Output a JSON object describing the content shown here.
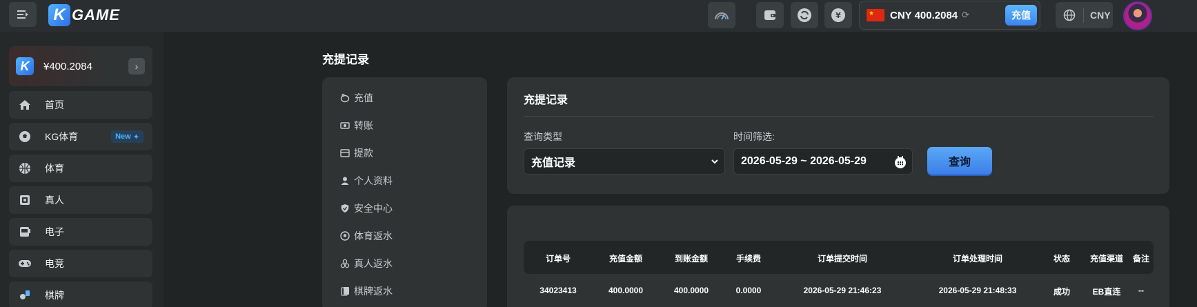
{
  "header": {
    "logo_k": "K",
    "logo_text": "GAME",
    "balance_currency_amount": "CNY 400.2084",
    "deposit_label": "充值",
    "currency_code": "CNY"
  },
  "sidebar": {
    "wallet_amount": "¥400.2084",
    "items": [
      {
        "label": "首页",
        "icon": "home-icon"
      },
      {
        "label": "KG体育",
        "icon": "soccer-ball-icon",
        "badge": "New"
      },
      {
        "label": "体育",
        "icon": "basketball-icon"
      },
      {
        "label": "真人",
        "icon": "cards-icon"
      },
      {
        "label": "电子",
        "icon": "slot-machine-icon"
      },
      {
        "label": "电竞",
        "icon": "gamepad-icon"
      },
      {
        "label": "棋牌",
        "icon": "chess-icon"
      }
    ]
  },
  "page": {
    "title": "充提记录"
  },
  "subnav": {
    "items": [
      {
        "label": "充值",
        "icon": "piggy-bank-icon"
      },
      {
        "label": "转账",
        "icon": "transfer-icon"
      },
      {
        "label": "提款",
        "icon": "withdraw-icon"
      },
      {
        "label": "个人资料",
        "icon": "user-icon"
      },
      {
        "label": "安全中心",
        "icon": "shield-icon"
      },
      {
        "label": "体育返水",
        "icon": "soccer-ball-icon"
      },
      {
        "label": "真人返水",
        "icon": "chips-icon"
      },
      {
        "label": "棋牌返水",
        "icon": "cards-icon"
      }
    ]
  },
  "filter": {
    "title": "充提记录",
    "query_type_label": "查询类型",
    "query_type_value": "充值记录",
    "time_label": "时间筛选:",
    "date_range": "2026-05-29 ~ 2026-05-29",
    "query_button": "查询"
  },
  "table": {
    "headers": [
      "订单号",
      "充值金额",
      "到账金额",
      "手续费",
      "订单提交时间",
      "订单处理时间",
      "状态",
      "充值渠道",
      "备注"
    ],
    "rows": [
      [
        "34023413",
        "400.0000",
        "400.0000",
        "0.0000",
        "2026-05-29 21:46:23",
        "2026-05-29 21:48:33",
        "成功",
        "EB直连",
        "--"
      ]
    ]
  },
  "colors": {
    "accent": "#3d84ef",
    "background": "#212425",
    "panel": "#2f3334"
  }
}
